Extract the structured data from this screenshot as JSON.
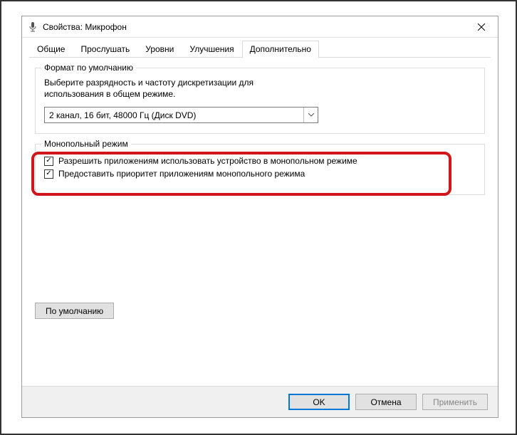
{
  "window": {
    "title": "Свойства: Микрофон"
  },
  "tabs": {
    "items": [
      {
        "label": "Общие"
      },
      {
        "label": "Прослушать"
      },
      {
        "label": "Уровни"
      },
      {
        "label": "Улучшения"
      },
      {
        "label": "Дополнительно"
      }
    ],
    "activeIndex": 4
  },
  "groups": {
    "format": {
      "title": "Формат по умолчанию",
      "description": "Выберите разрядность и частоту дискретизации для использования в общем режиме.",
      "select_value": "2 канал, 16 бит, 48000 Гц (Диск DVD)"
    },
    "exclusive": {
      "title": "Монопольный режим",
      "checkbox1": "Разрешить приложениям использовать устройство в монопольном режиме",
      "checkbox2": "Предоставить приоритет приложениям монопольного режима"
    }
  },
  "buttons": {
    "restore_default": "По умолчанию",
    "ok": "OK",
    "cancel": "Отмена",
    "apply": "Применить"
  }
}
